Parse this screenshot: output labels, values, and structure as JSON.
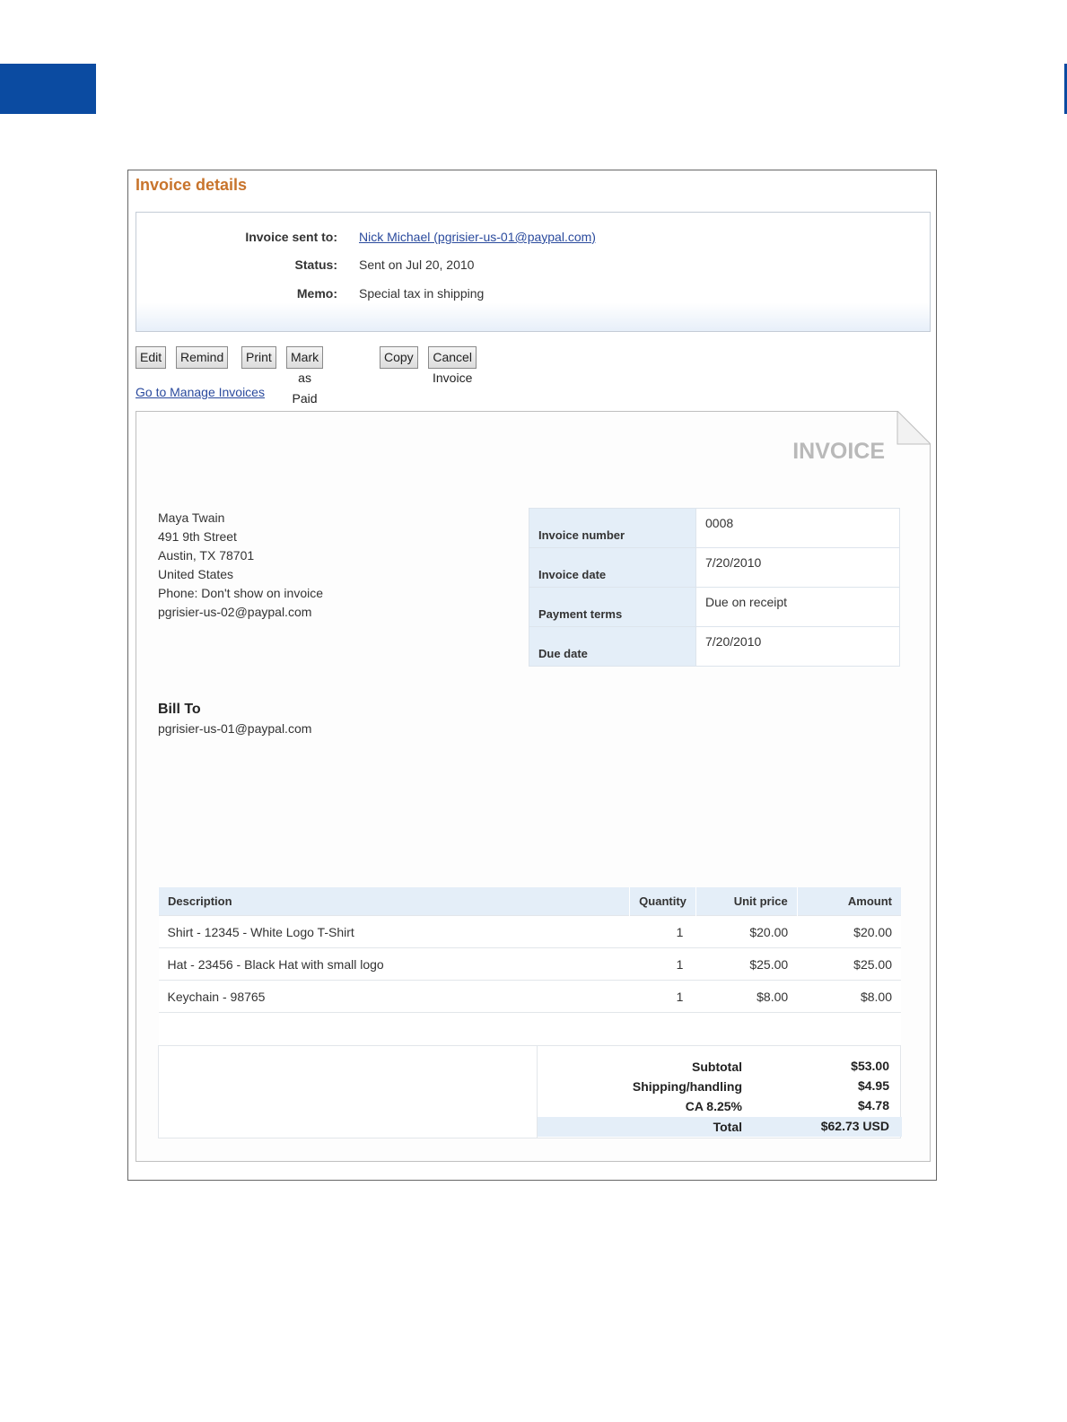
{
  "page": {
    "title": "Invoice details"
  },
  "summary": {
    "sent_to_label": "Invoice sent to:",
    "sent_to_value": "Nick Michael (pgrisier-us-01@paypal.com)",
    "status_label": "Status:",
    "status_value": "Sent on Jul 20, 2010",
    "memo_label": "Memo:",
    "memo_value": "Special tax in shipping"
  },
  "actions": {
    "edit": "Edit",
    "remind": "Remind",
    "print": "Print",
    "mark_paid": "Mark as Paid",
    "copy": "Copy",
    "cancel": "Cancel Invoice"
  },
  "manage_link": "Go to Manage Invoices",
  "invoice": {
    "heading": "INVOICE",
    "from": {
      "name": "Maya Twain",
      "street": "491 9th Street",
      "city": "Austin, TX 78701",
      "country": "United States",
      "phone": "Phone: Don't show on invoice",
      "email": "pgrisier-us-02@paypal.com"
    },
    "meta": [
      {
        "label": "Invoice number",
        "value": "0008"
      },
      {
        "label": "Invoice date",
        "value": "7/20/2010"
      },
      {
        "label": "Payment terms",
        "value": "Due on receipt"
      },
      {
        "label": "Due date",
        "value": "7/20/2010"
      }
    ],
    "bill_to": {
      "heading": "Bill To",
      "email": "pgrisier-us-01@paypal.com"
    },
    "table": {
      "headers": {
        "description": "Description",
        "quantity": "Quantity",
        "unit_price": "Unit price",
        "amount": "Amount"
      },
      "rows": [
        {
          "description": "Shirt - 12345 - White Logo T-Shirt",
          "quantity": "1",
          "unit_price": "$20.00",
          "amount": "$20.00"
        },
        {
          "description": "Hat - 23456 - Black Hat with small logo",
          "quantity": "1",
          "unit_price": "$25.00",
          "amount": "$25.00"
        },
        {
          "description": "Keychain - 98765",
          "quantity": "1",
          "unit_price": "$8.00",
          "amount": "$8.00"
        }
      ]
    },
    "totals": {
      "subtotal_label": "Subtotal",
      "subtotal_value": "$53.00",
      "shipping_label": "Shipping/handling",
      "shipping_value": "$4.95",
      "tax_label": "CA 8.25%",
      "tax_value": "$4.78",
      "total_label": "Total",
      "total_value": "$62.73 USD"
    }
  },
  "colors": {
    "accent_title": "#c8742c",
    "brand_blue": "#0b4ba1",
    "link": "#2a4a9d",
    "header_fill": "#e4eef8"
  }
}
